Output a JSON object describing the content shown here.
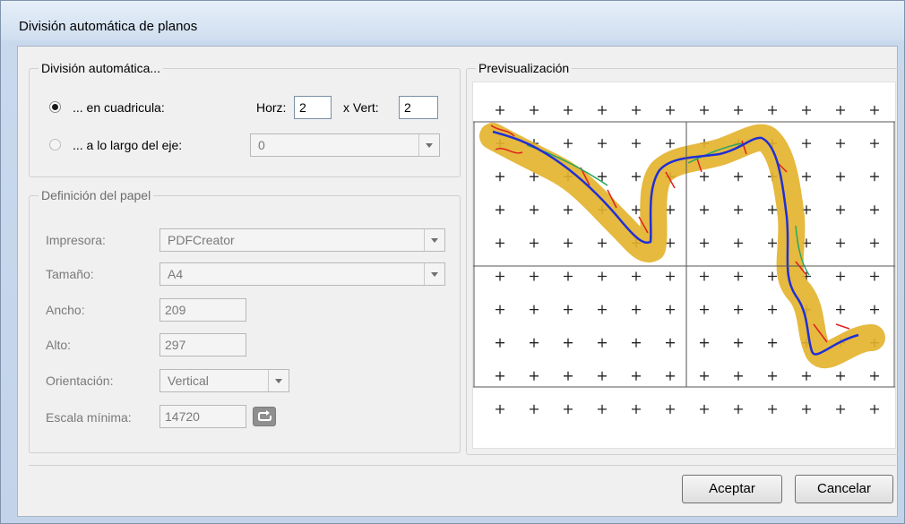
{
  "window": {
    "title": "División automática de planos"
  },
  "auto_division": {
    "legend": "División automática...",
    "grid_option": {
      "label": "... en cuadricula:",
      "selected": true
    },
    "horz_label": "Horz:",
    "horz_value": "2",
    "vert_label": "x Vert:",
    "vert_value": "2",
    "axis_option": {
      "label": "... a lo largo del eje:",
      "selected": false
    },
    "axis_value": "0"
  },
  "paper": {
    "legend": "Definición del papel",
    "printer_label": "Impresora:",
    "printer_value": "PDFCreator",
    "size_label": "Tamaño:",
    "size_value": "A4",
    "width_label": "Ancho:",
    "width_value": "209",
    "height_label": "Alto:",
    "height_value": "297",
    "orientation_label": "Orientación:",
    "orientation_value": "Vertical",
    "scale_label": "Escala mínima:",
    "scale_value": "14720"
  },
  "preview": {
    "legend": "Previsualización",
    "grid_columns": 2,
    "grid_rows": 2
  },
  "footer": {
    "accept_label": "Aceptar",
    "cancel_label": "Cancelar"
  },
  "colors": {
    "route_fill": "#e3b12a",
    "axis_line": "#1f2fd6",
    "detail_red": "#e02020",
    "detail_green": "#2aa860"
  },
  "icons": {
    "refresh": "refresh-icon",
    "dropdown": "chevron-down-icon"
  }
}
